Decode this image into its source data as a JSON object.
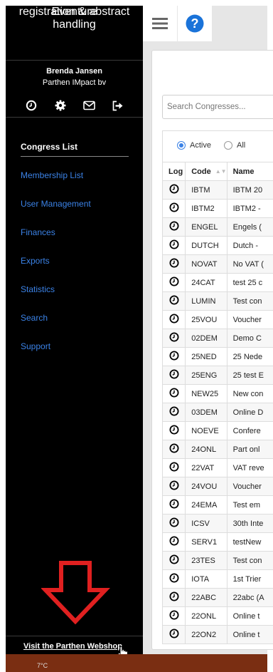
{
  "app": {
    "logo": "Eventure",
    "tagline": "registration & abstract handling"
  },
  "user": {
    "name": "Brenda Jansen",
    "company": "Parthen IMpact bv"
  },
  "sidebar_icons": [
    "clock-icon",
    "gear-icon",
    "envelope-icon",
    "logout-icon"
  ],
  "nav": {
    "items": [
      "Congress List",
      "Membership List",
      "User Management",
      "Finances",
      "Exports",
      "Statistics",
      "Search",
      "Support"
    ],
    "active": "Congress List"
  },
  "webshop_link": "Visit the Parthen Webshop",
  "taskbar": {
    "temperature": "7°C"
  },
  "search": {
    "placeholder": "Search Congresses..."
  },
  "filters": {
    "active": "Active",
    "all": "All"
  },
  "table": {
    "headers": {
      "log": "Log",
      "code": "Code",
      "name": "Name"
    },
    "rows": [
      {
        "code": "IBTM",
        "name": "IBTM 20"
      },
      {
        "code": "IBTM2",
        "name": "IBTM2 -"
      },
      {
        "code": "ENGEL",
        "name": "Engels ("
      },
      {
        "code": "DUTCH",
        "name": "Dutch -"
      },
      {
        "code": "NOVAT",
        "name": "No VAT ("
      },
      {
        "code": "24CAT",
        "name": "test 25 c"
      },
      {
        "code": "LUMIN",
        "name": "Test con"
      },
      {
        "code": "25VOU",
        "name": "Voucher"
      },
      {
        "code": "02DEM",
        "name": "Demo C"
      },
      {
        "code": "25NED",
        "name": "25 Nede"
      },
      {
        "code": "25ENG",
        "name": "25 test E"
      },
      {
        "code": "NEW25",
        "name": "New con"
      },
      {
        "code": "03DEM",
        "name": "Online D"
      },
      {
        "code": "NOEVE",
        "name": "Confere"
      },
      {
        "code": "24ONL",
        "name": "Part onl"
      },
      {
        "code": "22VAT",
        "name": "VAT reve"
      },
      {
        "code": "24VOU",
        "name": "Voucher"
      },
      {
        "code": "24EMA",
        "name": "Test em"
      },
      {
        "code": "ICSV",
        "name": "30th Inte"
      },
      {
        "code": "SERV1",
        "name": "testNew"
      },
      {
        "code": "23TES",
        "name": "Test con"
      },
      {
        "code": "IOTA",
        "name": "1st Trier"
      },
      {
        "code": "22ABC",
        "name": "22abc (A"
      },
      {
        "code": "22ONL",
        "name": "Online t"
      },
      {
        "code": "22ON2",
        "name": "Online t"
      }
    ]
  },
  "colors": {
    "sidebar": "#000000",
    "link": "#3b82e6",
    "help": "#1a73d9",
    "arrow": "#e02020"
  }
}
